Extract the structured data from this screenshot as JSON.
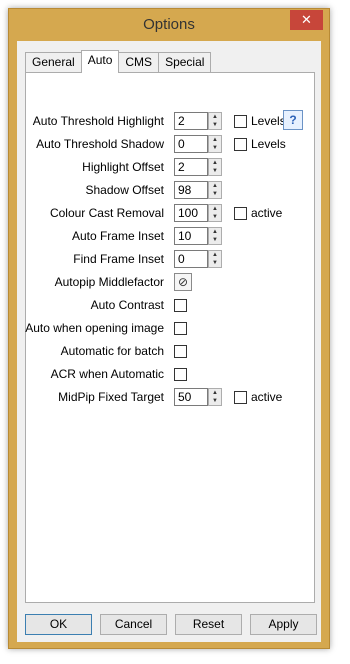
{
  "window": {
    "title": "Options",
    "close_label": "✕"
  },
  "tabs": [
    {
      "label": "General",
      "active": false
    },
    {
      "label": "Auto",
      "active": true
    },
    {
      "label": "CMS",
      "active": false
    },
    {
      "label": "Special",
      "active": false
    }
  ],
  "fields": {
    "auto_threshold_highlight": {
      "label": "Auto Threshold Highlight",
      "value": "2",
      "option": "Levels"
    },
    "auto_threshold_shadow": {
      "label": "Auto Threshold Shadow",
      "value": "0",
      "option": "Levels"
    },
    "highlight_offset": {
      "label": "Highlight Offset",
      "value": "2"
    },
    "shadow_offset": {
      "label": "Shadow Offset",
      "value": "98"
    },
    "colour_cast_removal": {
      "label": "Colour Cast Removal",
      "value": "100",
      "option": "active"
    },
    "auto_frame_inset": {
      "label": "Auto Frame Inset",
      "value": "10"
    },
    "find_frame_inset": {
      "label": "Find Frame Inset",
      "value": "0"
    },
    "autopip_middlefactor": {
      "label": "Autopip Middlefactor"
    },
    "auto_contrast": {
      "label": "Auto Contrast"
    },
    "auto_when_opening": {
      "label": "Auto when opening image"
    },
    "automatic_for_batch": {
      "label": "Automatic for batch"
    },
    "acr_when_automatic": {
      "label": "ACR when Automatic"
    },
    "midpip_fixed_target": {
      "label": "MidPip Fixed Target",
      "value": "50",
      "option": "active"
    }
  },
  "buttons": {
    "ok": "OK",
    "cancel": "Cancel",
    "reset": "Reset",
    "apply": "Apply"
  },
  "icons": {
    "spin_up": "up-arrow-icon",
    "spin_down": "down-arrow-icon",
    "help": "question-icon",
    "circle_slash": "circle-slash-icon"
  }
}
